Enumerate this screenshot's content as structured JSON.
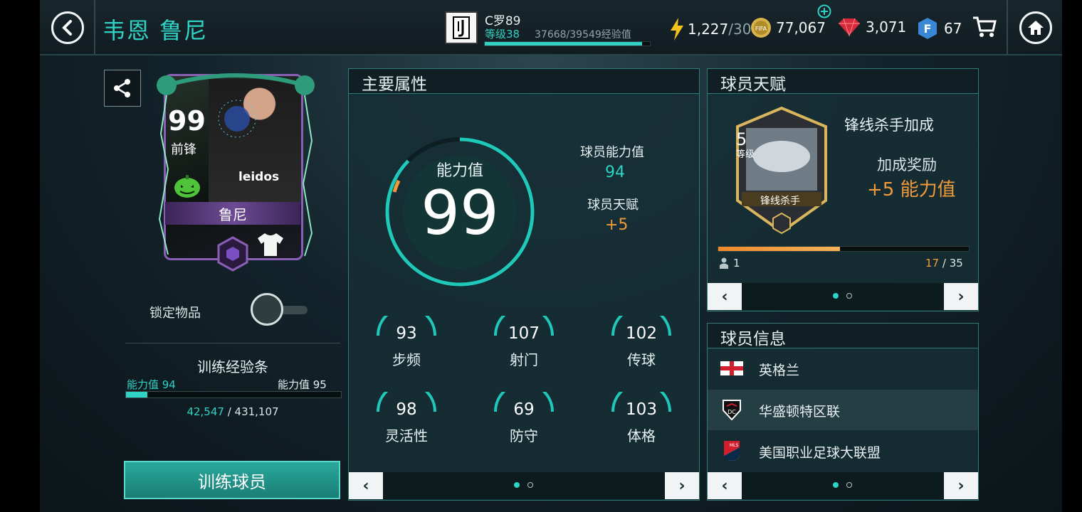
{
  "header": {
    "player_title": "韦恩 鲁尼",
    "team_name": "C罗89",
    "level_label": "等级38",
    "xp_text": "37668/39549经验值",
    "xp_progress": 0.952,
    "energy_value": "1,227",
    "energy_max": "/30",
    "coins": "77,067",
    "gems": "3,071",
    "fifa_points": "67"
  },
  "icons": [
    "back-icon",
    "juventus-logo",
    "lightning-icon",
    "fifa-coin-icon",
    "plus-icon",
    "gem-icon",
    "fifa-points-icon",
    "cart-icon",
    "home-icon",
    "share-icon",
    "chevron-left-icon",
    "chevron-right-icon"
  ],
  "card": {
    "rating": "99",
    "position": "前锋",
    "name": "鲁尼",
    "kit_text": "leidos"
  },
  "lock": {
    "label": "锁定物品",
    "enabled": false
  },
  "training": {
    "title": "训练经验条",
    "from_label": "能力值 94",
    "to_label": "能力值 95",
    "current": "42,547",
    "separator": " / ",
    "total": "431,107",
    "progress": 0.0987,
    "button_label": "训练球员"
  },
  "attributes": {
    "title": "主要属性",
    "ovr_label": "能力值",
    "ovr_value": "99",
    "base_label": "球员能力值",
    "base_value": "94",
    "talent_label": "球员天赋",
    "talent_value": "+5",
    "stats": [
      {
        "name": "步频",
        "value": "93"
      },
      {
        "name": "射门",
        "value": "107"
      },
      {
        "name": "传球",
        "value": "102"
      },
      {
        "name": "灵活性",
        "value": "98"
      },
      {
        "name": "防守",
        "value": "69"
      },
      {
        "name": "体格",
        "value": "103"
      }
    ],
    "page": 1,
    "pages": 2
  },
  "talent": {
    "title": "球员天赋",
    "level_num": "5",
    "level_label": "等级",
    "badge_name": "锋线杀手",
    "name": "锋线杀手加成",
    "bonus_label": "加成奖励",
    "bonus_value": "+5 能力值",
    "owned": "1",
    "progress_current": "17",
    "progress_sep": " / ",
    "progress_total": "35",
    "progress": 0.486
  },
  "info": {
    "title": "球员信息",
    "rows": [
      {
        "text": "英格兰",
        "icon": "england-flag-icon"
      },
      {
        "text": "华盛顿特区联",
        "icon": "dc-united-crest-icon"
      },
      {
        "text": "美国职业足球大联盟",
        "icon": "mls-logo-icon"
      }
    ]
  },
  "colors": {
    "accent": "#2fd2c4",
    "orange": "#f39a3a",
    "card_purple": "#8a5fb6"
  }
}
